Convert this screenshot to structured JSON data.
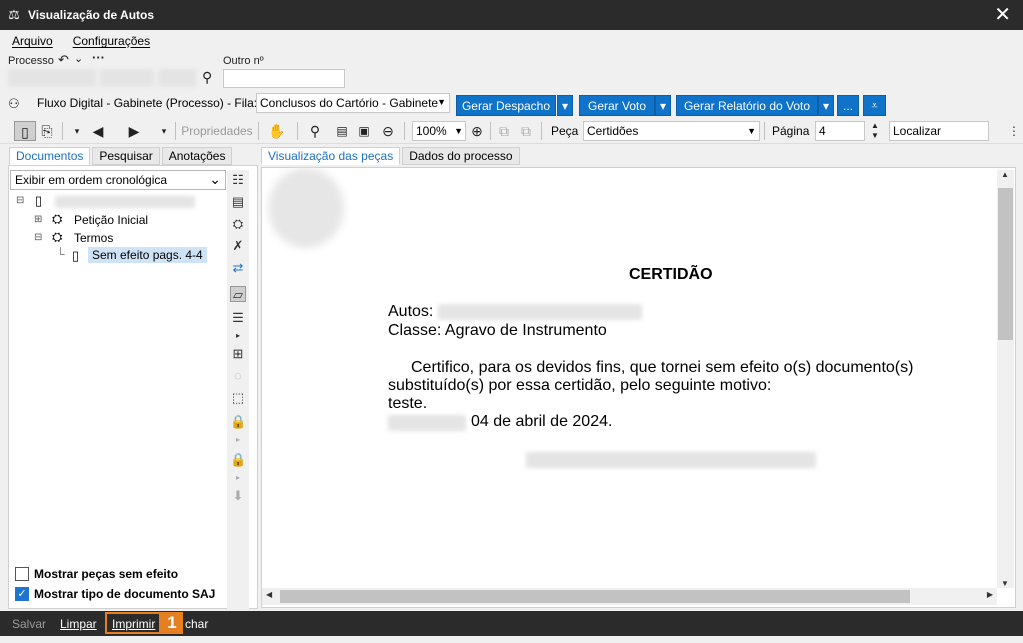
{
  "window": {
    "title": "Visualização de Autos",
    "app_icon": "scales-icon",
    "close_label": "✕"
  },
  "menu": {
    "items": [
      "Arquivo",
      "Configurações"
    ]
  },
  "process": {
    "label": "Processo",
    "outro_label": "Outro nº",
    "outro_value": ""
  },
  "flow": {
    "label": "Fluxo Digital - Gabinete (Processo) - Fila:",
    "queue": "Conclusos do Cartório - Gabinete",
    "buttons": [
      "Gerar Despacho",
      "Gerar Voto",
      "Gerar Relatório do Voto",
      "..."
    ]
  },
  "toolbar": {
    "properties_label": "Propriedades",
    "zoom": "100%",
    "peca_label": "Peça",
    "peca_value": "Certidões",
    "pagina_label": "Página",
    "pagina_value": "4",
    "localizar_placeholder": "Localizar"
  },
  "left_tabs": [
    "Documentos",
    "Pesquisar",
    "Anotações"
  ],
  "order_select": "Exibir em ordem cronológica",
  "tree": {
    "items": [
      "Petição Inicial",
      "Termos",
      "Sem efeito pags. 4-4"
    ]
  },
  "checkboxes": [
    {
      "label": "Mostrar peças sem efeito",
      "checked": false
    },
    {
      "label": "Mostrar tipo de documento SAJ",
      "checked": true
    }
  ],
  "viewer_tabs": [
    "Visualização das peças",
    "Dados do processo"
  ],
  "document": {
    "title": "CERTIDÃO",
    "autos_label": "Autos:",
    "classe": "Classe: Agravo de Instrumento",
    "line1": "Certifico, para os devidos fins, que tornei sem efeito o(s) documento(s)",
    "line2": "substituído(s) por essa certidão, pelo seguinte motivo:",
    "line3": "teste.",
    "date": "04 de abril de 2024."
  },
  "bottom": {
    "salvar": "Salvar",
    "limpar": "Limpar",
    "imprimir": "Imprimir",
    "fechar": "char",
    "badge": "1"
  },
  "colors": {
    "accent": "#0f73c9",
    "highlight": "#e67e22",
    "titlebar": "#2b2b2b"
  }
}
